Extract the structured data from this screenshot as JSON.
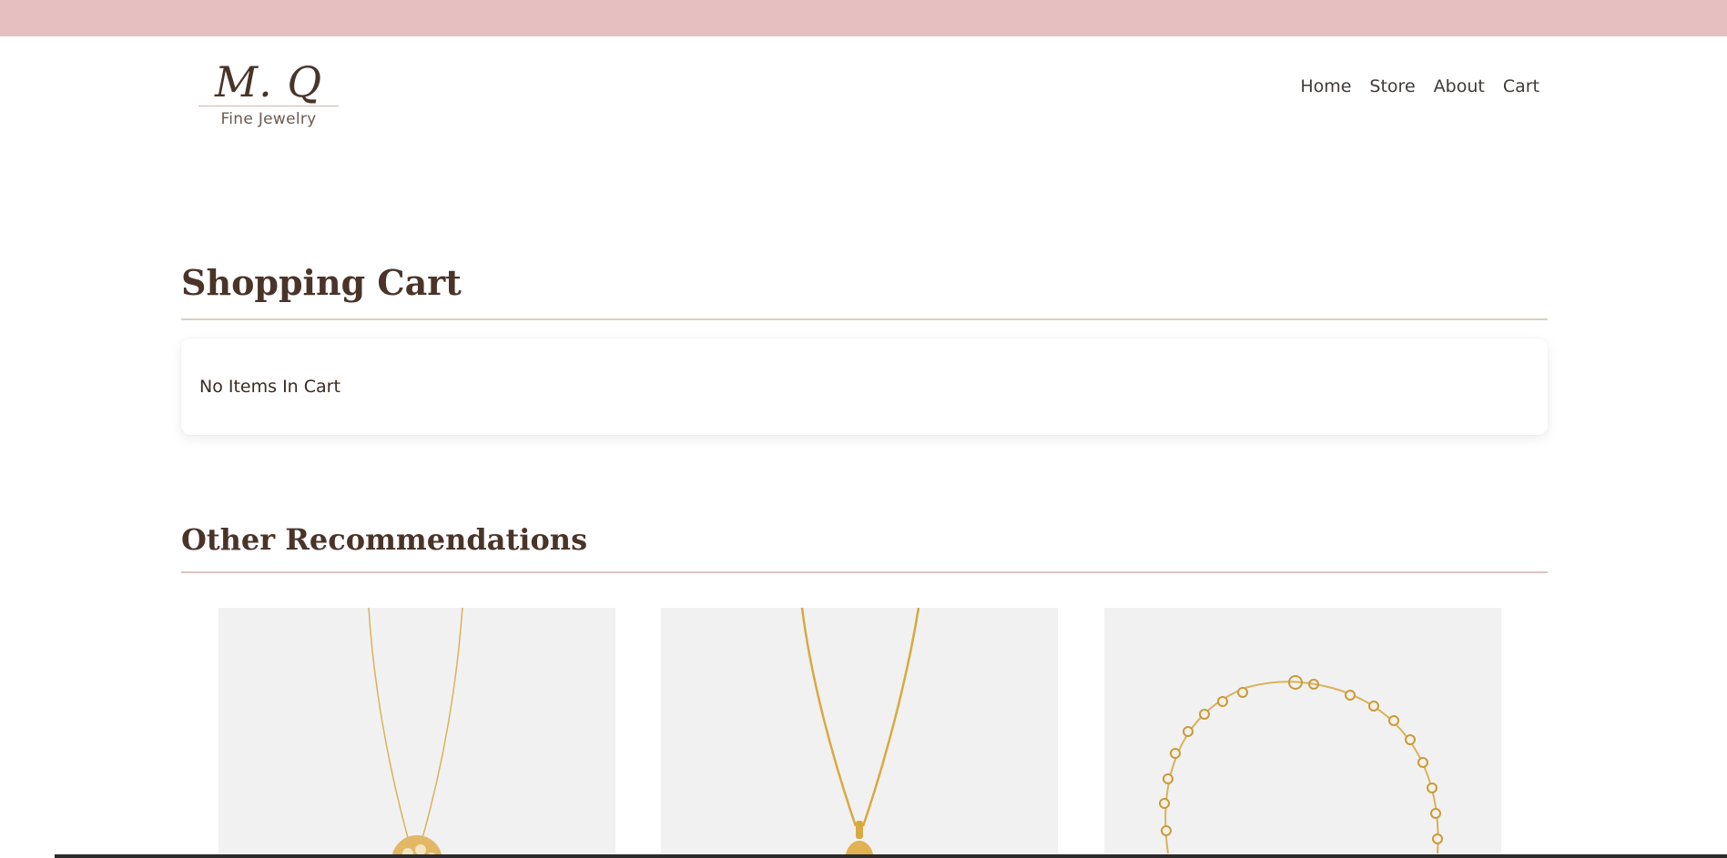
{
  "brand": {
    "mark": "M. Q",
    "subtitle": "Fine Jewelry"
  },
  "nav": {
    "items": [
      "Home",
      "Store",
      "About",
      "Cart"
    ]
  },
  "cart": {
    "title": "Shopping Cart",
    "empty_message": "No Items In Cart"
  },
  "recommendations": {
    "title": "Other Recommendations",
    "items": [
      {
        "type": "necklace with pave disc pendant"
      },
      {
        "type": "necklace with gold pendant"
      },
      {
        "type": "diamond station bracelet"
      }
    ]
  },
  "colors": {
    "top_band": "#e6c0c1",
    "heading": "#4a3429",
    "card_bg": "#f1f1f1",
    "gold": "#d9b25a"
  }
}
